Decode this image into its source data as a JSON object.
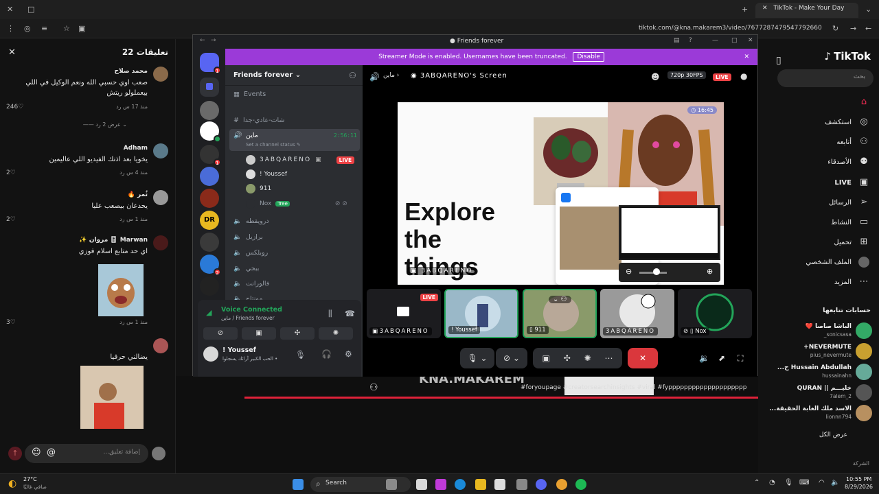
{
  "browser": {
    "tab_title": "TikTok - Make Your Day",
    "url": "tiktok.com/@kna.makarem3/video/7677287479547792660"
  },
  "comments": {
    "header": "تعليقات 22",
    "items": [
      {
        "name": "محمد صلاح",
        "text": "صعب اوي حسبي الله ونعم الوكيل في اللي بيعملولو ريتش",
        "meta": "منذ 17 س   رد",
        "likes": "246",
        "replies": "عرض 2 رد"
      },
      {
        "name": "Adham",
        "text": "يخويا بعد اذنك الفيديو اللي عاليمين",
        "meta": "منذ 4 س   رد",
        "likes": "2"
      },
      {
        "name": "ثُمر 🔥",
        "text": "يحدعان بيصعب عليا",
        "meta": "منذ 1 س   رد",
        "likes": "2"
      },
      {
        "name": "Marwan 🎚️ مروان ✨",
        "text": "اي حد متابع اسلام فوزي",
        "meta": "منذ 1 س   رد",
        "likes": "3"
      },
      {
        "name": "",
        "text": "يضالني حرفيا",
        "meta": "",
        "likes": ""
      }
    ],
    "input_placeholder": "إضافة تعليق...",
    "at_symbol": "@"
  },
  "tiktok": {
    "logo": "TikTok",
    "search_placeholder": "بحث",
    "nav": [
      "استكشف",
      "أتابعه",
      "الأصدقاء",
      "LIVE",
      "الرسائل",
      "النشاط",
      "تحميل",
      "الملف الشخصي",
      "المزيد"
    ],
    "following_header": "حسابات تتابعها",
    "following": [
      {
        "name": "الباشا صاصا ❤️",
        "user": "sonicsasa_",
        "color": "#3a6"
      },
      {
        "name": "NEVERMUTE+",
        "user": "pius_nevermute",
        "color": "#c8a030"
      },
      {
        "name": "Hussain Abdullah ح...",
        "user": "hussainahn",
        "color": "#6a9"
      },
      {
        "name": "خليـــم || QURAN",
        "user": "7alem_2",
        "color": "#555"
      },
      {
        "name": "الاسد ملك الغابة الحقيقة...",
        "user": "lionnn794",
        "color": "#b89060"
      }
    ],
    "see_all": "عرض الكل",
    "company": "الشركة"
  },
  "video": {
    "watermark": "KNA.MAKAREM",
    "hashtags": "#foryoupage #creatorsearchinsights #viral #fypppppppppppppppppppp"
  },
  "discord": {
    "window_title": "Friends forever",
    "streamer_banner": "Streamer Mode is enabled. Usernames have been truncated.",
    "disable_label": "Disable",
    "server_name": "Friends forever",
    "events": "Events",
    "text_channel": "شات-عادي-جدا",
    "voice_channel": "ماين",
    "voice_time": "2:56:11",
    "channel_status": "Set a channel status",
    "voice_users": [
      "3ABQARENO",
      "! Youssef",
      "911",
      "Nox"
    ],
    "nox_tag": "Tree",
    "live_label": "LIVE",
    "other_channels": [
      "درويقطه",
      "برازيل",
      "روبلكس",
      "ببجي",
      "فالورانت",
      "مونتاج"
    ],
    "voice_connected": "Voice Connected",
    "voice_sub": "ماين / Friends forever",
    "user_name": "! Youssef",
    "user_status": "الحب الكبير آرائك يسجلوا •",
    "screen_title": "3ABQARENO's Screen",
    "breadcrumb": "ماين",
    "quality": "720p 30FPS",
    "stream_headline": [
      "Explore",
      "the",
      "things"
    ],
    "stream_time": "16:45",
    "stream_caption": "3ABQARENO",
    "tiles": [
      "3ABQARENO",
      "! Youssef",
      "911",
      "3ABQARENO",
      "Nox"
    ]
  },
  "taskbar": {
    "weather_temp": "27°C",
    "weather_desc": "صافي غالبًا",
    "search": "Search",
    "time": "10:55 PM",
    "date": "8/29/2026"
  }
}
